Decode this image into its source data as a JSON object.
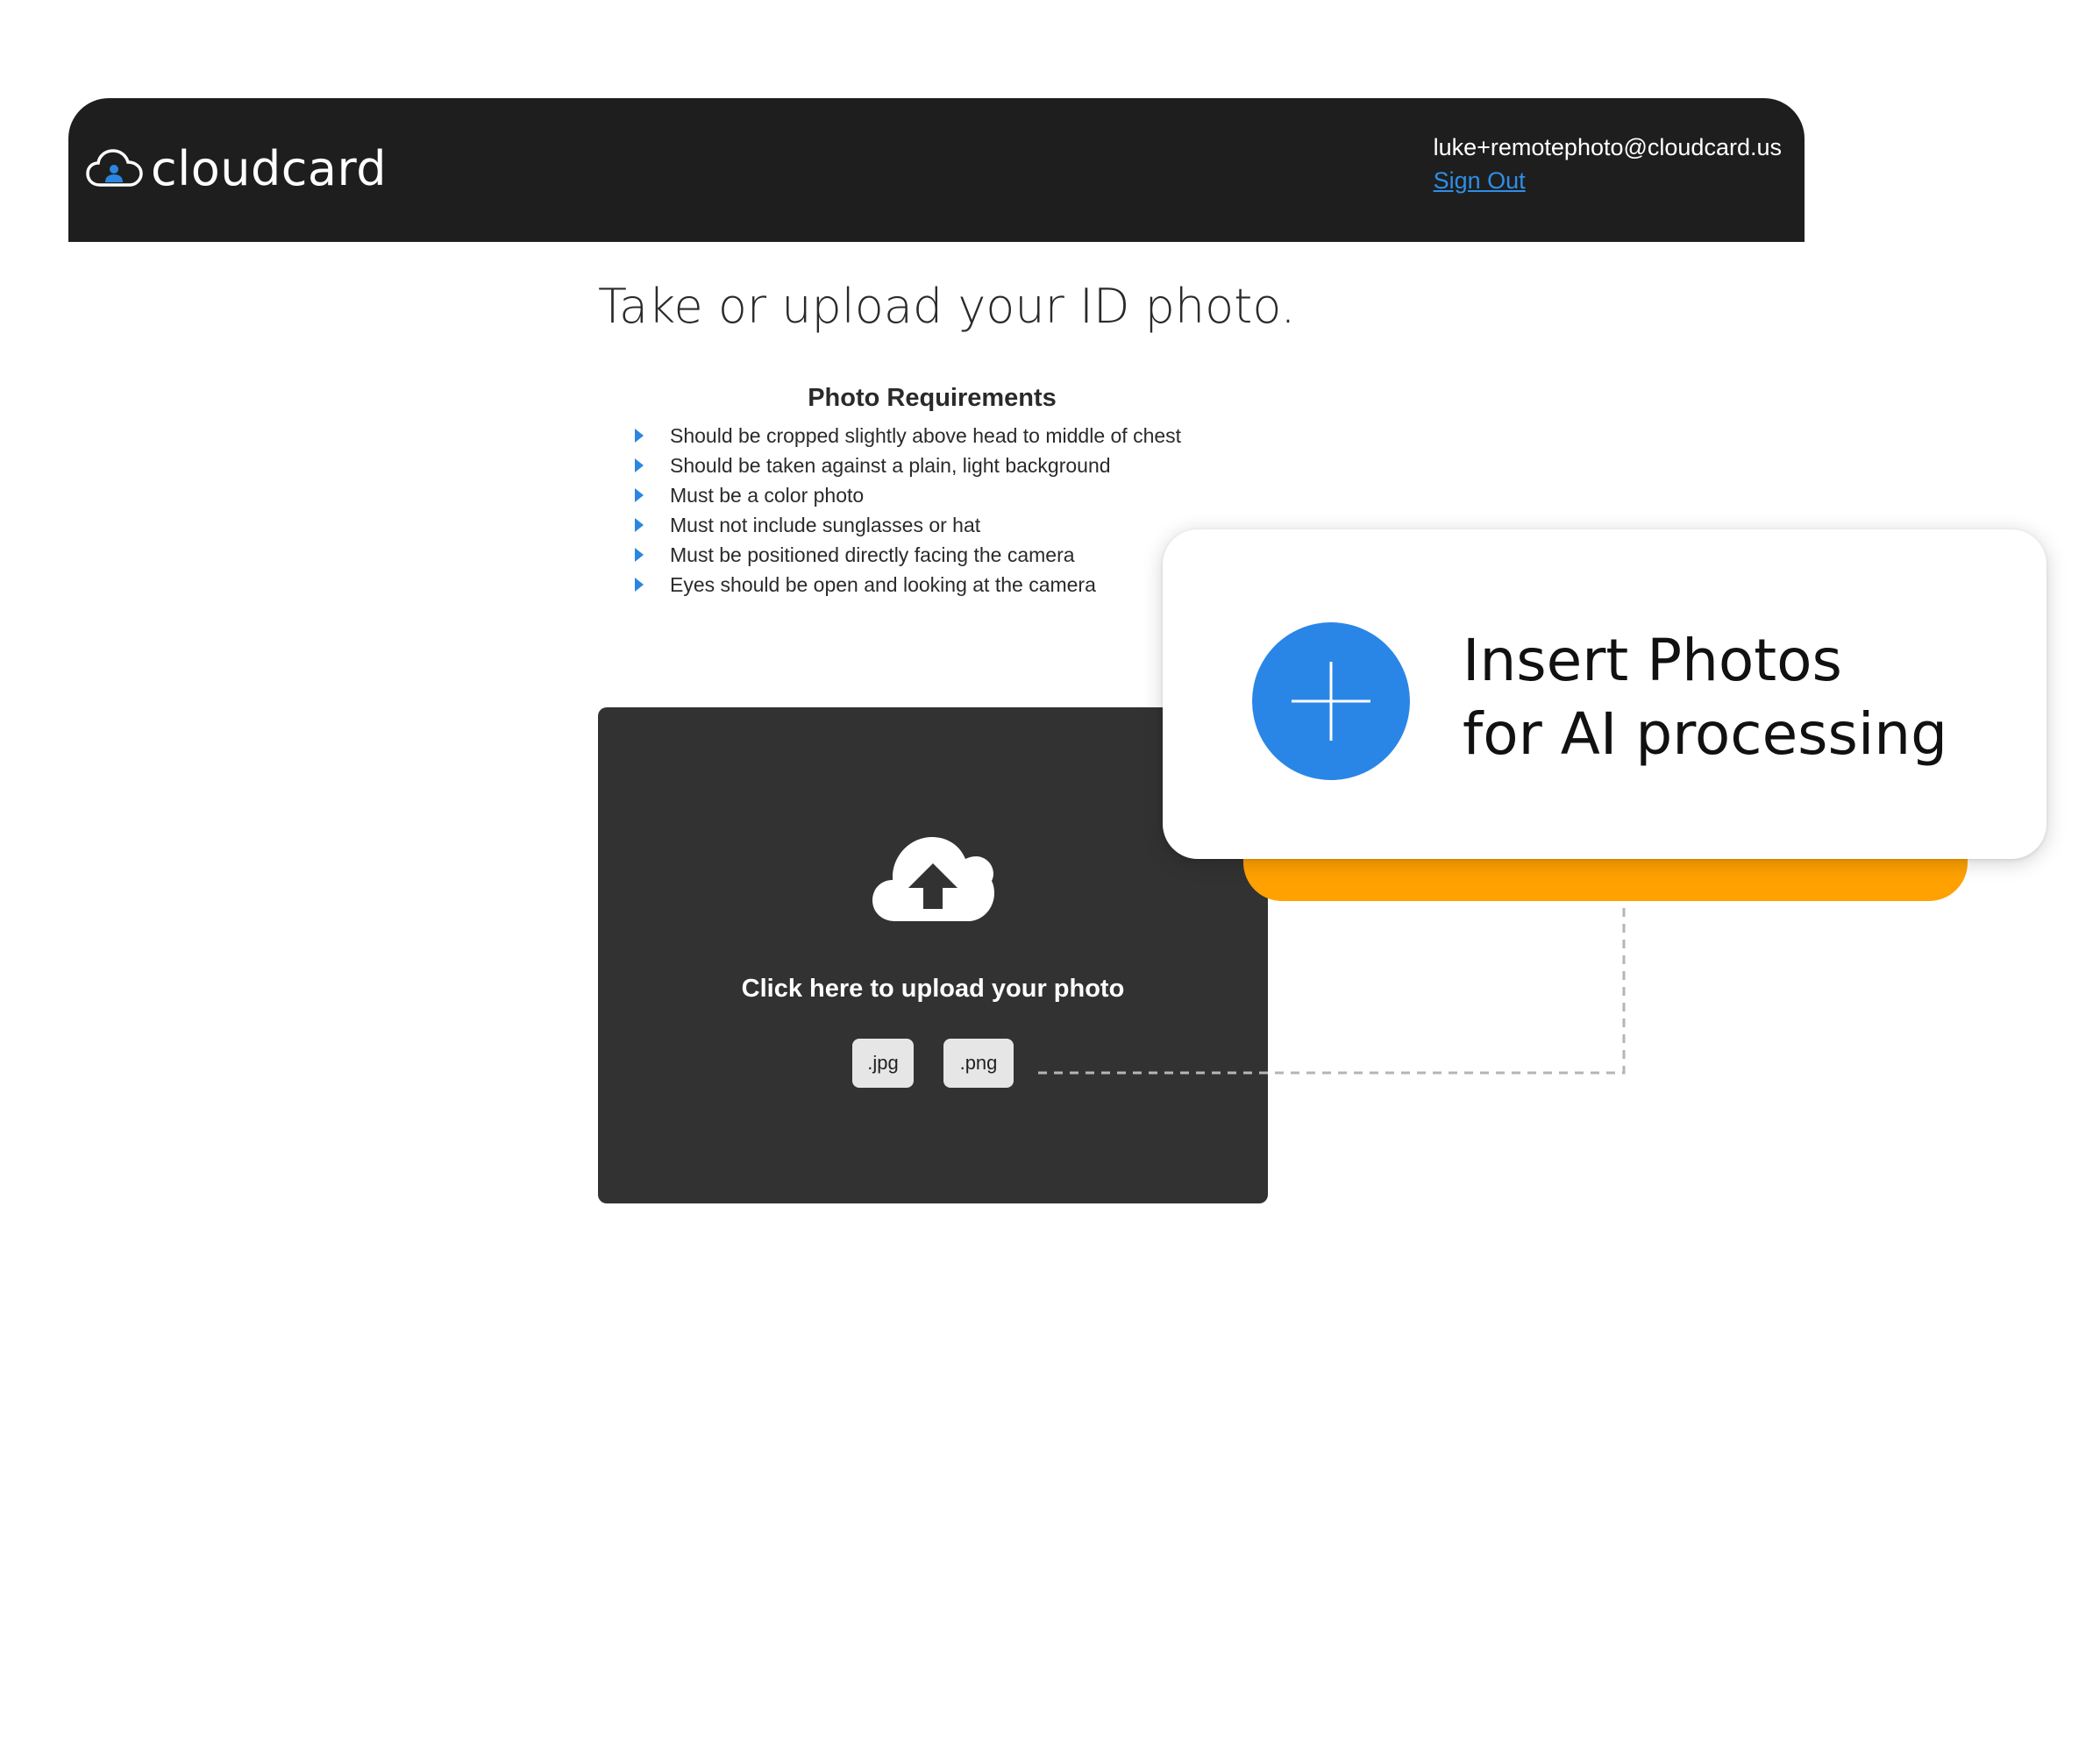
{
  "header": {
    "logo_text": "cloudcard",
    "user_email": "luke+remotephoto@cloudcard.us",
    "sign_out_label": "Sign Out"
  },
  "main": {
    "title": "Take or upload your ID photo.",
    "requirements": {
      "heading": "Photo Requirements",
      "items": [
        "Should be cropped slightly above head to middle of chest",
        "Should be taken against a plain, light background",
        "Must be a color photo",
        "Must not include sunglasses or hat",
        "Must be positioned directly facing the camera",
        "Eyes should be open and looking at the camera"
      ]
    },
    "upload": {
      "icon": "cloud-upload-icon",
      "label": "Click here to upload your photo",
      "formats": [
        ".jpg",
        ".png"
      ]
    }
  },
  "insert_card": {
    "icon": "plus-icon",
    "line1": "Insert Photos",
    "line2": "for AI processing"
  },
  "colors": {
    "header_bg": "#1e1e1e",
    "link_blue": "#2f8ee6",
    "accent_orange": "#ffa100",
    "plus_blue": "#2a86e6",
    "dropzone_bg": "#323232"
  }
}
